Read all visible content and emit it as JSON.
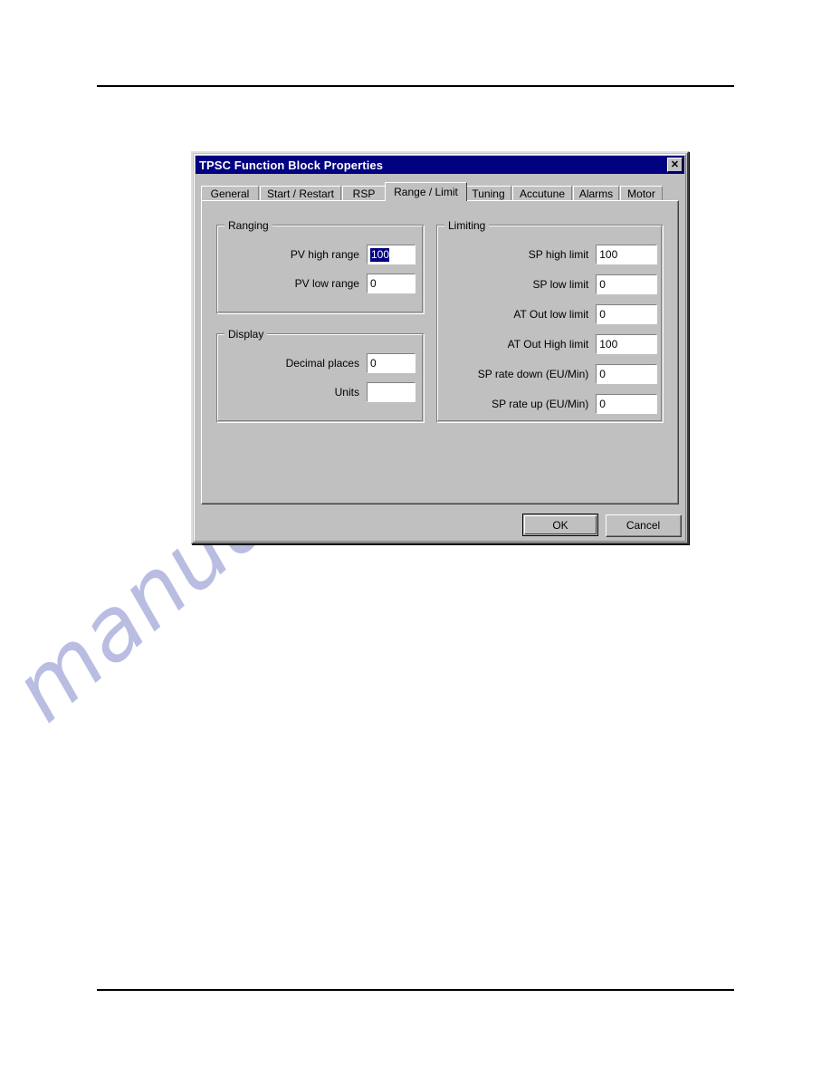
{
  "page": {
    "background": "#ffffff",
    "rule_color": "#000000",
    "watermark_text": "manualshive.c"
  },
  "dialog": {
    "title": "TPSC Function Block Properties",
    "titlebar_color": "#000080",
    "face_color": "#c0c0c0",
    "close_button": {
      "label": "✕",
      "name": "close-icon"
    },
    "tabs": [
      {
        "label": "General",
        "active": false
      },
      {
        "label": "Start / Restart",
        "active": false
      },
      {
        "label": "RSP",
        "active": false
      },
      {
        "label": "Range / Limit",
        "active": true
      },
      {
        "label": "Tuning",
        "active": false
      },
      {
        "label": "Accutune",
        "active": false
      },
      {
        "label": "Alarms",
        "active": false
      },
      {
        "label": "Motor",
        "active": false
      }
    ],
    "groups": {
      "ranging": {
        "title": "Ranging",
        "fields": [
          {
            "label": "PV high range",
            "value": "100",
            "selected": true
          },
          {
            "label": "PV low range",
            "value": "0",
            "selected": false
          }
        ]
      },
      "display": {
        "title": "Display",
        "fields": [
          {
            "label": "Decimal places",
            "value": "0",
            "selected": false
          },
          {
            "label": "Units",
            "value": "",
            "selected": false
          }
        ]
      },
      "limiting": {
        "title": "Limiting",
        "fields": [
          {
            "label": "SP high limit",
            "value": "100",
            "selected": false
          },
          {
            "label": "SP low limit",
            "value": "0",
            "selected": false
          },
          {
            "label": "AT Out low limit",
            "value": "0",
            "selected": false
          },
          {
            "label": "AT Out High limit",
            "value": "100",
            "selected": false
          },
          {
            "label": "SP rate down (EU/Min)",
            "value": "0",
            "selected": false
          },
          {
            "label": "SP rate up (EU/Min)",
            "value": "0",
            "selected": false
          }
        ]
      }
    },
    "buttons": {
      "ok": "OK",
      "cancel": "Cancel"
    }
  }
}
